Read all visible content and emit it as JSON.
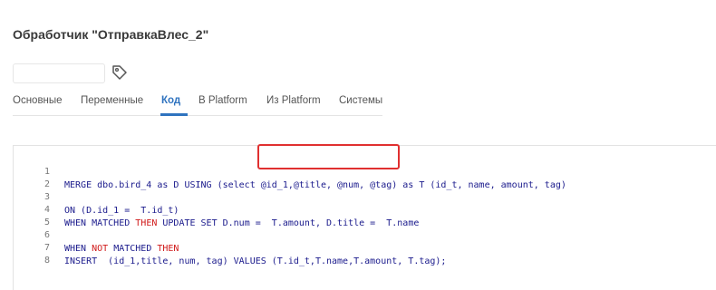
{
  "header": {
    "title": "Обработчик \"ОтправкаВлес_2\""
  },
  "name_field": {
    "value": "",
    "placeholder": ""
  },
  "tag_button": {
    "icon": "tag-icon"
  },
  "tabs": [
    {
      "label": "Основные",
      "active": false
    },
    {
      "label": "Переменные",
      "active": false
    },
    {
      "label": "Код",
      "active": true
    },
    {
      "label": "В Platform",
      "active": false
    },
    {
      "label": "Из Platform",
      "active": false
    },
    {
      "label": "Системы",
      "active": false
    }
  ],
  "code": {
    "lines": [
      {
        "num": "1",
        "text": "MERGE dbo.bird_4 as D USING (select @id_1,@title, @num, @tag) as T (id_t, name, amount, tag)"
      },
      {
        "num": "2",
        "text": ""
      },
      {
        "num": "3",
        "text": "ON (D.id_1 =  T.id_t)"
      },
      {
        "num": "4",
        "prefix": "WHEN MATCHED ",
        "keyword": "THEN",
        "suffix": " UPDATE SET D.num =  T.amount, D.title =  T.name"
      },
      {
        "num": "5",
        "text": ""
      },
      {
        "num": "6",
        "prefix": "WHEN ",
        "keyword": "NOT",
        "middle": " MATCHED ",
        "keyword2": "THEN",
        "suffix": ""
      },
      {
        "num": "7",
        "text": "INSERT  (id_1,title, num, tag) VALUES (T.id_t,T.name,T.amount, T.tag);"
      },
      {
        "num": "8",
        "text": ""
      }
    ]
  },
  "colors": {
    "accent": "#2f73bf",
    "keyword_red": "#d01a1a",
    "code_blue": "#1a1a8c",
    "highlight": "#e03030"
  }
}
